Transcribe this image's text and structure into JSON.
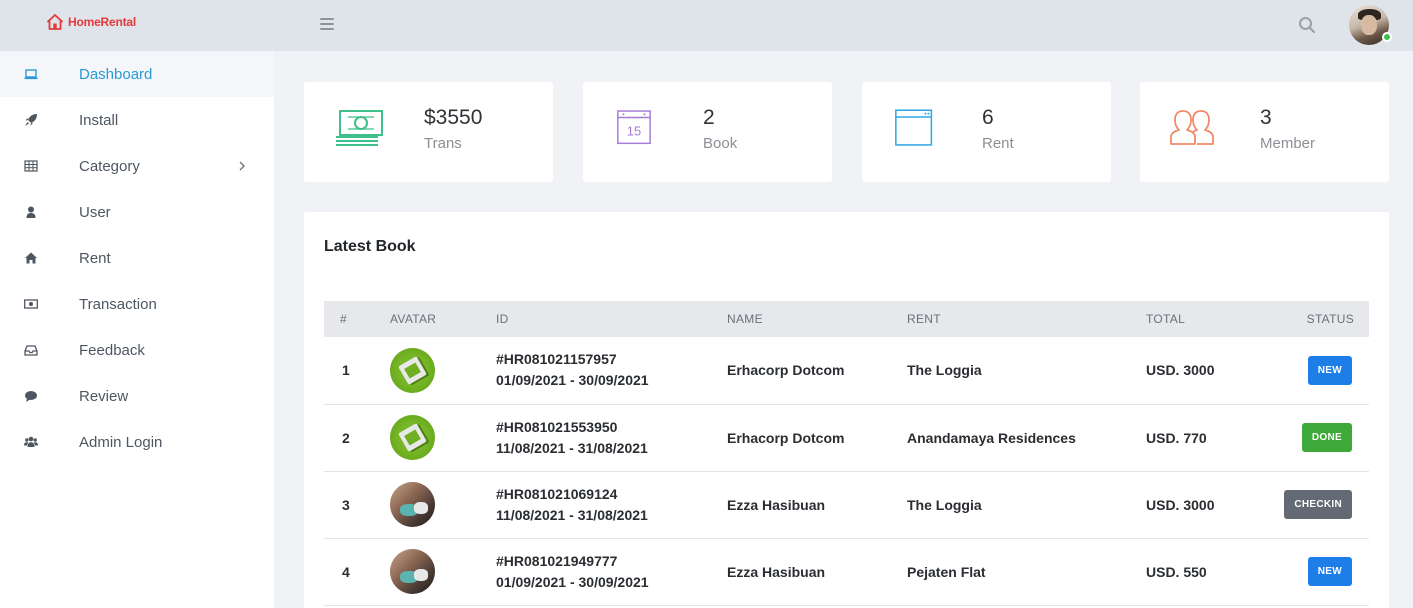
{
  "app": {
    "brand": "HomeRental",
    "colors": {
      "accent": "#2a9ad6",
      "brand_red": "#e23b3b",
      "topbar": "#dfe3ea"
    }
  },
  "header": {
    "menu_icon": "hamburger-icon",
    "search_icon": "search-icon",
    "avatar": "user-avatar",
    "online": true
  },
  "sidebar": {
    "items": [
      {
        "label": "Dashboard",
        "icon": "laptop-icon",
        "active": true
      },
      {
        "label": "Install",
        "icon": "rocket-icon"
      },
      {
        "label": "Category",
        "icon": "table-icon",
        "has_children": true
      },
      {
        "label": "User",
        "icon": "user-icon"
      },
      {
        "label": "Rent",
        "icon": "home-icon"
      },
      {
        "label": "Transaction",
        "icon": "money-icon"
      },
      {
        "label": "Feedback",
        "icon": "inbox-icon"
      },
      {
        "label": "Review",
        "icon": "comment-icon"
      },
      {
        "label": "Admin Login",
        "icon": "users-icon"
      }
    ]
  },
  "stats": [
    {
      "value": "$3550",
      "label": "Trans",
      "icon": "cash-icon",
      "color": "#3fbf8a"
    },
    {
      "value": "2",
      "label": "Book",
      "icon": "calendar-icon",
      "color": "#a57bd6"
    },
    {
      "value": "6",
      "label": "Rent",
      "icon": "browser-window-icon",
      "color": "#2fa8e6"
    },
    {
      "value": "3",
      "label": "Member",
      "icon": "users-outline-icon",
      "color": "#f08a6a"
    }
  ],
  "latest_book": {
    "title": "Latest Book",
    "columns": [
      "#",
      "AVATAR",
      "ID",
      "NAME",
      "RENT",
      "TOTAL",
      "STATUS"
    ],
    "rows": [
      {
        "num": "1",
        "avatar": "green-book-avatar",
        "id": "#HR081021157957",
        "dates": "01/09/2021 - 30/09/2021",
        "name": "Erhacorp Dotcom",
        "rent": "The Loggia",
        "total": "USD. 3000",
        "status": "NEW"
      },
      {
        "num": "2",
        "avatar": "green-book-avatar",
        "id": "#HR081021553950",
        "dates": "11/08/2021 - 31/08/2021",
        "name": "Erhacorp Dotcom",
        "rent": "Anandamaya Residences",
        "total": "USD. 770",
        "status": "DONE"
      },
      {
        "num": "3",
        "avatar": "photo-avatar",
        "id": "#HR081021069124",
        "dates": "11/08/2021 - 31/08/2021",
        "name": "Ezza Hasibuan",
        "rent": "The Loggia",
        "total": "USD. 3000",
        "status": "CHECKIN"
      },
      {
        "num": "4",
        "avatar": "photo-avatar",
        "id": "#HR081021949777",
        "dates": "01/09/2021 - 30/09/2021",
        "name": "Ezza Hasibuan",
        "rent": "Pejaten Flat",
        "total": "USD. 550",
        "status": "NEW"
      }
    ]
  }
}
